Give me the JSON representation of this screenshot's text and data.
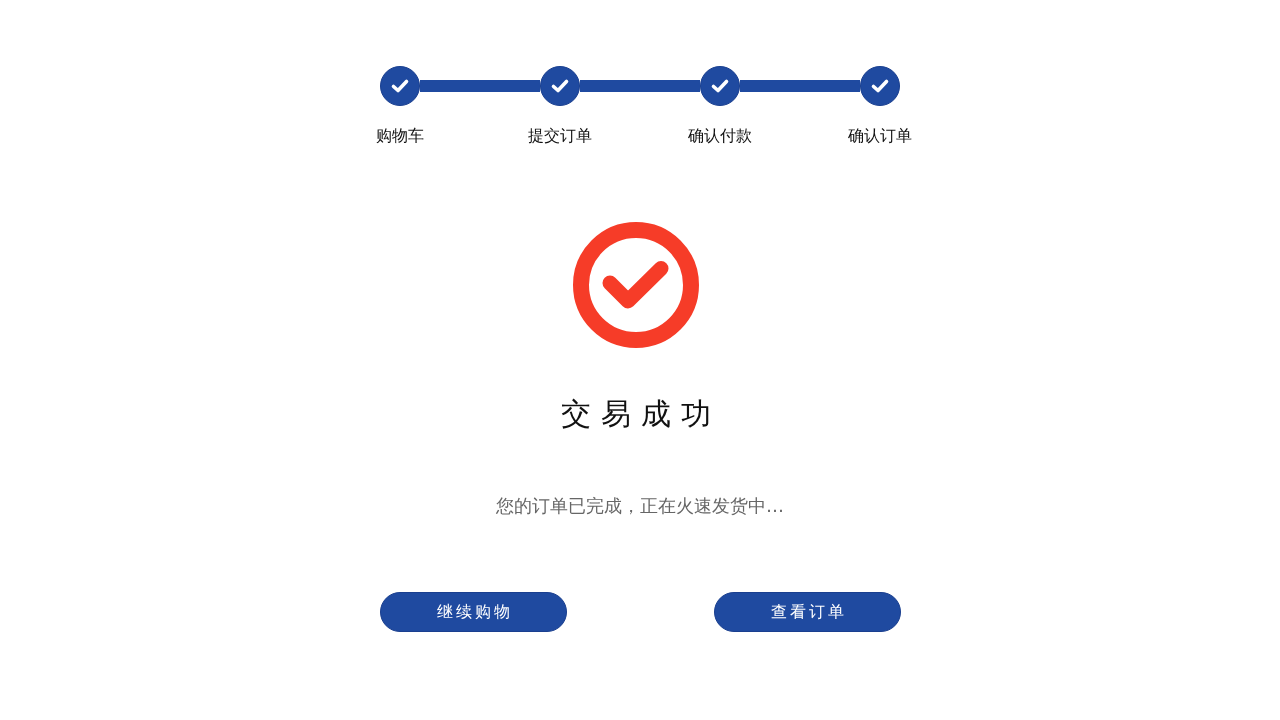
{
  "steps": [
    {
      "label": "购物车",
      "done": true
    },
    {
      "label": "提交订单",
      "done": true
    },
    {
      "label": "确认付款",
      "done": true
    },
    {
      "label": "确认订单",
      "done": true
    }
  ],
  "result": {
    "title": "交易成功",
    "message": "您的订单已完成，正在火速发货中…"
  },
  "buttons": [
    "继续购物",
    "查看订单"
  ]
}
